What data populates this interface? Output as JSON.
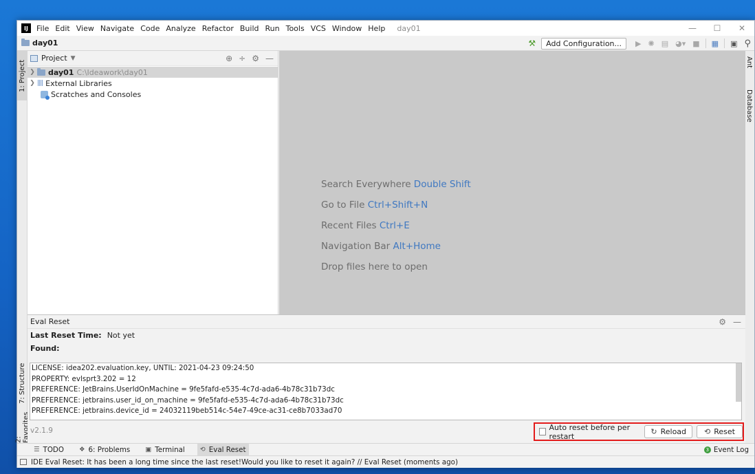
{
  "menu": {
    "items": [
      "File",
      "Edit",
      "View",
      "Navigate",
      "Code",
      "Analyze",
      "Refactor",
      "Build",
      "Run",
      "Tools",
      "VCS",
      "Window",
      "Help"
    ],
    "project_title": "day01"
  },
  "navbar": {
    "title": "day01",
    "add_config_label": "Add Configuration..."
  },
  "left_strip": {
    "project_tab": "1: Project",
    "structure_tab": "7: Structure",
    "favorites_tab": "2: Favorites"
  },
  "right_strip": {
    "ant_tab": "Ant",
    "database_tab": "Database"
  },
  "project_panel": {
    "header": "Project",
    "tree": [
      {
        "name": "day01",
        "path": "C:\\Ideawork\\day01"
      },
      {
        "name": "External Libraries"
      },
      {
        "name": "Scratches and Consoles"
      }
    ]
  },
  "editor": {
    "hints": [
      {
        "text": "Search Everywhere",
        "key": "Double Shift"
      },
      {
        "text": "Go to File",
        "key": "Ctrl+Shift+N"
      },
      {
        "text": "Recent Files",
        "key": "Ctrl+E"
      },
      {
        "text": "Navigation Bar",
        "key": "Alt+Home"
      },
      {
        "text": "Drop files here to open",
        "key": ""
      }
    ]
  },
  "eval_panel": {
    "title": "Eval Reset",
    "last_reset_label": "Last Reset Time:",
    "last_reset_value": "Not yet",
    "found_label": "Found:",
    "log_lines": [
      "LICENSE: idea202.evaluation.key, UNTIL: 2021-04-23 09:24:50",
      "PROPERTY: evlsprt3.202 = 12",
      "PREFERENCE: JetBrains.UserIdOnMachine = 9fe5fafd-e535-4c7d-ada6-4b78c31b73dc",
      "PREFERENCE: jetbrains.user_id_on_machine = 9fe5fafd-e535-4c7d-ada6-4b78c31b73dc",
      "PREFERENCE: jetbrains.device_id = 24032119beb514c-54e7-49ce-ac31-ce8b7033ad70"
    ],
    "version": "v2.1.9",
    "auto_reset_label": "Auto reset before per restart",
    "reload_label": "Reload",
    "reset_label": "Reset"
  },
  "bottom_tabs": {
    "todo": "TODO",
    "problems": "6: Problems",
    "terminal": "Terminal",
    "eval_reset": "Eval Reset",
    "event_log": "Event Log",
    "event_count": "3"
  },
  "status": {
    "message": "IDE Eval Reset: It has been a long time since the last reset!Would you like to reset it again? // Eval Reset (moments ago)"
  },
  "colors": {
    "accent_blue": "#3f78c1",
    "highlight_red": "#e31b1b",
    "editor_bg": "#c9c9c9"
  }
}
